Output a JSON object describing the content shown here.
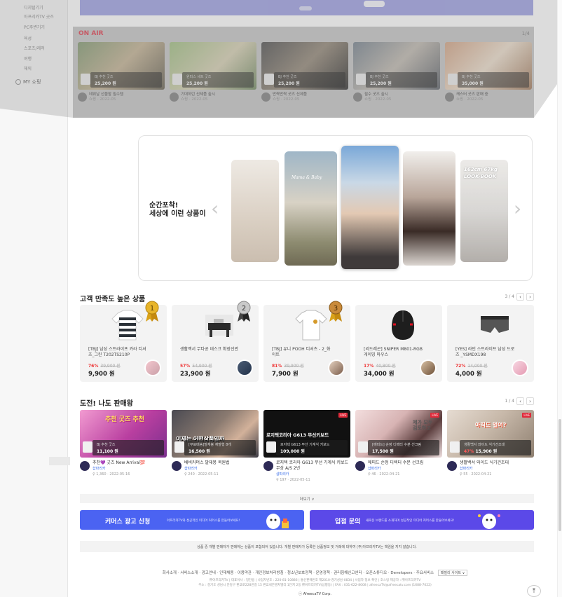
{
  "sidebar": {
    "items": [
      "디지털기기",
      "아프리카TV 굿즈",
      "PC주변기기",
      "육성",
      "스포츠/레저",
      "여행",
      "해외"
    ],
    "my_shop": "MY 쇼핑"
  },
  "onair": {
    "title": "ON AIR",
    "pager": "1/4",
    "cards": [
      {
        "price": "25,200 원",
        "product": "BJ 추천 굿즈",
        "caption": "데뷔날 선물할 필수템",
        "meta": "쇼핑 · 2022-05"
      },
      {
        "price": "25,200 원",
        "product": "원피스 세트 굿즈",
        "caption": "기대하던 신제품 출시",
        "meta": "쇼핑 · 2022-05"
      },
      {
        "price": "25,200 원",
        "product": "BJ 추천 굿즈",
        "caption": "반짝반짝 굿즈 신제품",
        "meta": "쇼핑 · 2022-05"
      },
      {
        "price": "25,200 원",
        "product": "BJ 추천 굿즈",
        "caption": "필수 굿즈 출시",
        "meta": "쇼핑 · 2022-05"
      },
      {
        "price": "35,000 원",
        "product": "BJ 추천 굿즈",
        "caption": "캐스터 굿즈 판매 중",
        "meta": "쇼핑 · 2022-05"
      }
    ]
  },
  "moment": {
    "line1": "순간포착!",
    "line2": "세상에 이런 상품이",
    "video_caption_1": "Mama & Baby",
    "video_caption_2": "162cm 67kg",
    "video_caption_3": "LOOK-BOOK"
  },
  "satisfaction": {
    "title": "고객 만족도 높은 상품",
    "pager": "3 / 4",
    "products": [
      {
        "name": "[TBJ] 남성 스트라이프 카라 티셔츠_그린 T202TS210P",
        "discount": "76%",
        "original": "39,900 원",
        "price": "9,900 원",
        "medal": "1"
      },
      {
        "name": "생활백서 무타공 데스크 확장선반",
        "discount": "57%",
        "original": "54,900 원",
        "price": "23,900 원",
        "medal": "2"
      },
      {
        "name": "[TBJ] 유니 POOH 티셔츠 - 2_화이트",
        "discount": "81%",
        "original": "39,900 원",
        "price": "7,900 원",
        "medal": "3"
      },
      {
        "name": "[리드레곤] SNIPER M801-RGB 게이밍 마우스",
        "discount": "17%",
        "original": "40,800 원",
        "price": "34,000 원",
        "medal": ""
      },
      {
        "name": "[YES] 라인 스트라이프 남성 드로즈 _YSMDX198",
        "discount": "72%",
        "original": "14,000 원",
        "price": "4,000 원",
        "medal": ""
      }
    ]
  },
  "challenge": {
    "title": "도전! 나도 판매왕",
    "pager": "1 / 4",
    "live_label": "LIVE",
    "cards": [
      {
        "thumb_text": "추천 굿즈 추천",
        "product": "BJ 추천 굿즈",
        "price": "11,100 원",
        "title": "추천💜 굿즈 New Arrival💯",
        "host": "샵파리카",
        "meta": "♀ 1,360 · 2022-05-16"
      },
      {
        "thumb_text": "이제는 어떤상품일까",
        "product": "[무료배송]발재봉 재발행 8개",
        "price": "16,500 원",
        "title": "베비커머스 발재봉 복원법",
        "host": "샵파리카",
        "meta": "♀ 240 · 2022-05-11"
      },
      {
        "thumb_text": "로지텍코리아 G613 무선키보드",
        "product": "로지텍 G613 무선 기계식 키보드",
        "price": "109,000 원",
        "title": "로지텍 코리아 G613 무선 기계식 키보드 무상 A/S 2년",
        "host": "샵파리카",
        "meta": "♀ 197 · 2022-05-11"
      },
      {
        "thumb_text": "제가 모두 검토하고",
        "product": "[에띠드] 순정 디렉터 수분 선크림",
        "price": "17,500 원",
        "title": "에띠드 순정 디렉터 수분 선크림",
        "host": "샵파리카",
        "meta": "♀ 46 · 2022-04-21"
      },
      {
        "thumb_text": "아직도 벌여?",
        "product": "생활백서 와이드 식기건조대",
        "price": "15,900 원",
        "discount": "47%",
        "title": "생활백서 와이드 식기건조대",
        "host": "샵파리카",
        "meta": "♀ 55 · 2022-04-21"
      }
    ],
    "more": "더보기 ∨"
  },
  "banners": {
    "ad_title": "커머스 광고 신청",
    "ad_sub": "아프리카TV와 성공적인 미디어 커머스를 만들어보세요!",
    "store_title": "입점 문의",
    "store_sub": "새로운 브랜드를 소개하며 성공적인 미디어 커머스를 만들어보세요!"
  },
  "notice": "상품 중 개별 판매자가 판매하는 상품이 포함되어 있습니다. 개별 판매자가 등록한 상품정보 및 거래에 대하여 (주)아프리카TV는 책임을 지지 않습니다.",
  "footer": {
    "links": "회사소개 · 서비스소개 · 광고안내 · 인재채용 · 이용약관 · 개인정보처리방침 · 청소년보호정책 · 운영정책 · 권리침해신고센터 · 오픈스튜디오 · Developers · 주요서비스",
    "family": "패밀리 사이트 ∨",
    "info1": "㈜아프리카TV | 대표이사 : 정찬용 | 사업자번호 : 220-81-10886 | 통신판매번호 제2010-경기성남-0834 | 사업자 정보 확인 | 호스팅 제공자 : ㈜아프리카TV",
    "info2": "주소 : 경기도 성남시 분당구 판교로228번길 15 판교세븐벤처밸리 1단지 2동 ㈜아프리카TV(삼평동) | FAX : 031-622-8008 | afreecaTV@afreecatv.com (1688-7022)",
    "copyright": "ⓒ AfreecaTV Corp."
  },
  "colors": {
    "accent_blue": "#4b63f2",
    "accent_purple": "#5b49e8",
    "live_red": "#e02a3a",
    "discount_red": "#e33333"
  }
}
